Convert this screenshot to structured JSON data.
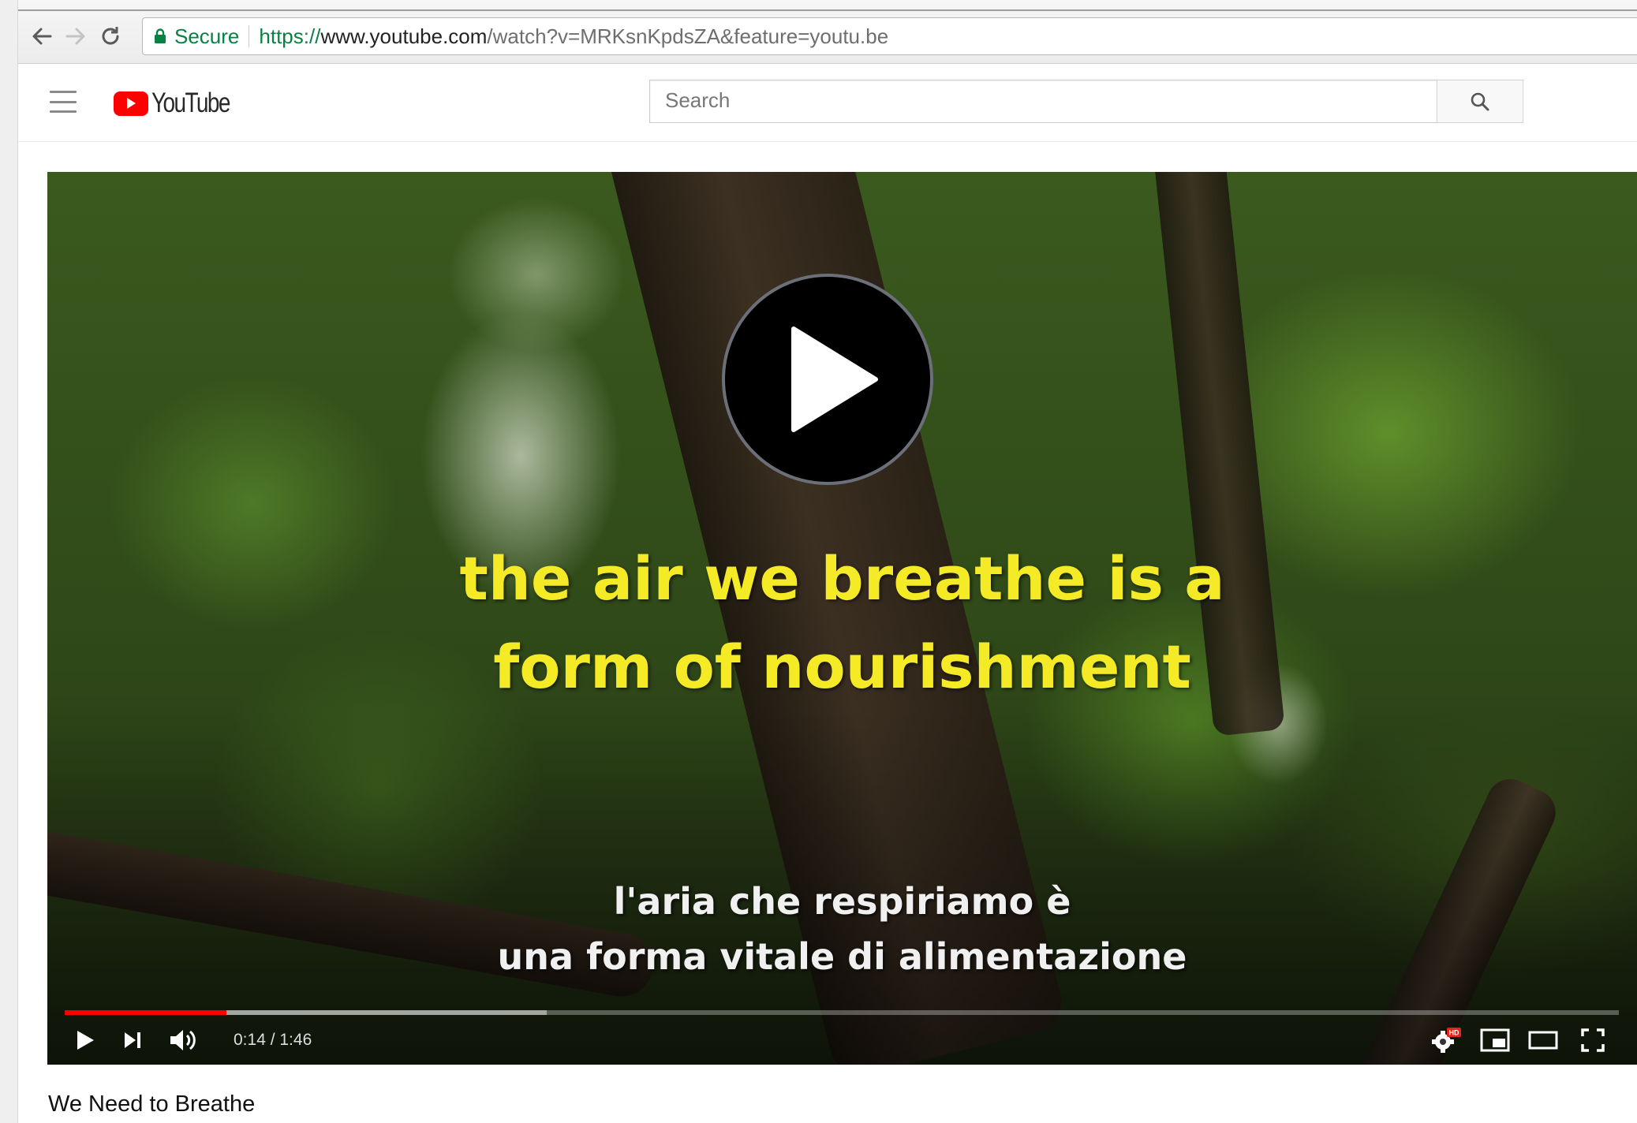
{
  "browser": {
    "secure_label": "Secure",
    "url_scheme": "https://",
    "url_host": "www.youtube.com",
    "url_path": "/watch?v=MRKsnKpdsZA&feature=youtu.be"
  },
  "masthead": {
    "logo_text": "YouTube",
    "search_placeholder": "Search",
    "search_value": ""
  },
  "player": {
    "caption_en_lines": [
      "the air we breathe is a",
      "form of nourishment"
    ],
    "caption_it_lines": [
      "l'aria che respiriamo è",
      "una forma vitale di alimentazione"
    ],
    "time_display": "0:14 / 1:46",
    "progress_played": 0.104,
    "progress_loaded": 0.31,
    "hd_badge": "HD",
    "colors": {
      "caption_en": "#f4ea25",
      "progress": "#ff0000",
      "brand": "#ff0000",
      "secure": "#0b8043"
    }
  },
  "video": {
    "title": "We Need to Breathe"
  },
  "icons": {
    "back": "arrow-left-icon",
    "forward": "arrow-right-icon",
    "reload": "reload-icon",
    "lock": "lock-icon",
    "menu": "hamburger-menu-icon",
    "search": "search-icon",
    "play": "play-icon",
    "next": "skip-next-icon",
    "volume": "volume-icon",
    "settings": "gear-icon",
    "miniplayer": "miniplayer-icon",
    "theater": "theater-mode-icon",
    "fullscreen": "fullscreen-icon"
  }
}
